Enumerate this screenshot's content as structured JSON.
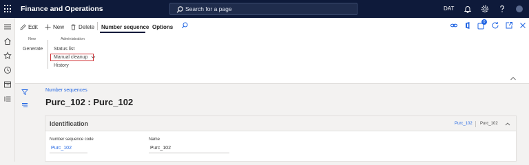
{
  "app": {
    "title": "Finance and Operations"
  },
  "search": {
    "placeholder": "Search for a page"
  },
  "topbar": {
    "company": "DAT"
  },
  "actionpane": {
    "edit_label": "Edit",
    "new_label": "New",
    "delete_label": "Delete",
    "tabs": [
      {
        "label": "Number sequence",
        "active": true
      },
      {
        "label": "Options",
        "active": false
      }
    ],
    "notification_count": "0",
    "groups": {
      "new": {
        "title": "New",
        "buttons": [
          "Generate"
        ]
      },
      "administration": {
        "title": "Administration",
        "buttons": [
          "Status list",
          "Manual cleanup",
          "History"
        ]
      }
    }
  },
  "breadcrumb": "Number sequences",
  "page_title": "Purc_102 : Purc_102",
  "identification": {
    "title": "Identification",
    "summary_code": "Purc_102",
    "summary_name": "Purc_102",
    "fields": {
      "code_label": "Number sequence code",
      "code_value": "Purc_102",
      "name_label": "Name",
      "name_value": "Purc_102"
    }
  },
  "colors": {
    "nav_bg": "#0e1a3a",
    "accent": "#2266e3",
    "highlight": "#d13438"
  }
}
